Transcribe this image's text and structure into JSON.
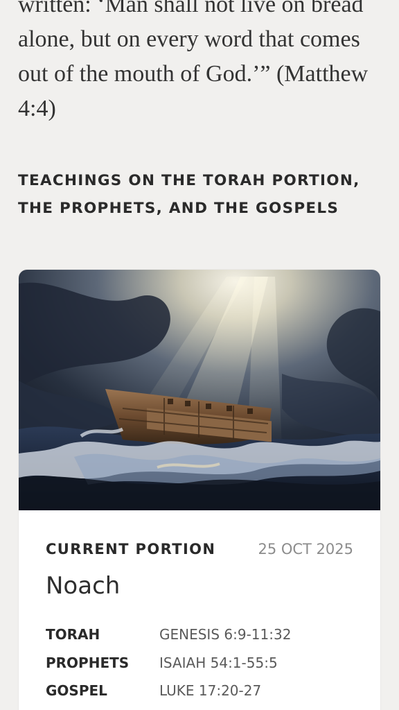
{
  "quote": {
    "text": "written: ‘Man shall not live on bread alone, but on every word that comes out of the mouth of God.’” (Matthew 4:4)"
  },
  "section": {
    "heading": "TEACHINGS ON THE TORAH PORTION, THE PROPHETS, AND THE GOSPELS"
  },
  "card": {
    "image_subject": "Painting of an ark on a stormy sea under rays of light",
    "current_label": "CURRENT PORTION",
    "date": "25 OCT 2025",
    "portion_name": "Noach",
    "readings": [
      {
        "label": "TORAH",
        "value": "GENESIS 6:9-11:32"
      },
      {
        "label": "PROPHETS",
        "value": "ISAIAH 54:1-55:5"
      },
      {
        "label": "GOSPEL",
        "value": "LUKE 17:20-27"
      }
    ]
  },
  "colors": {
    "background": "#f1f0ee",
    "text_dark": "#2a2a2a",
    "text_muted": "#8c8c8c",
    "card_bg": "#ffffff"
  }
}
